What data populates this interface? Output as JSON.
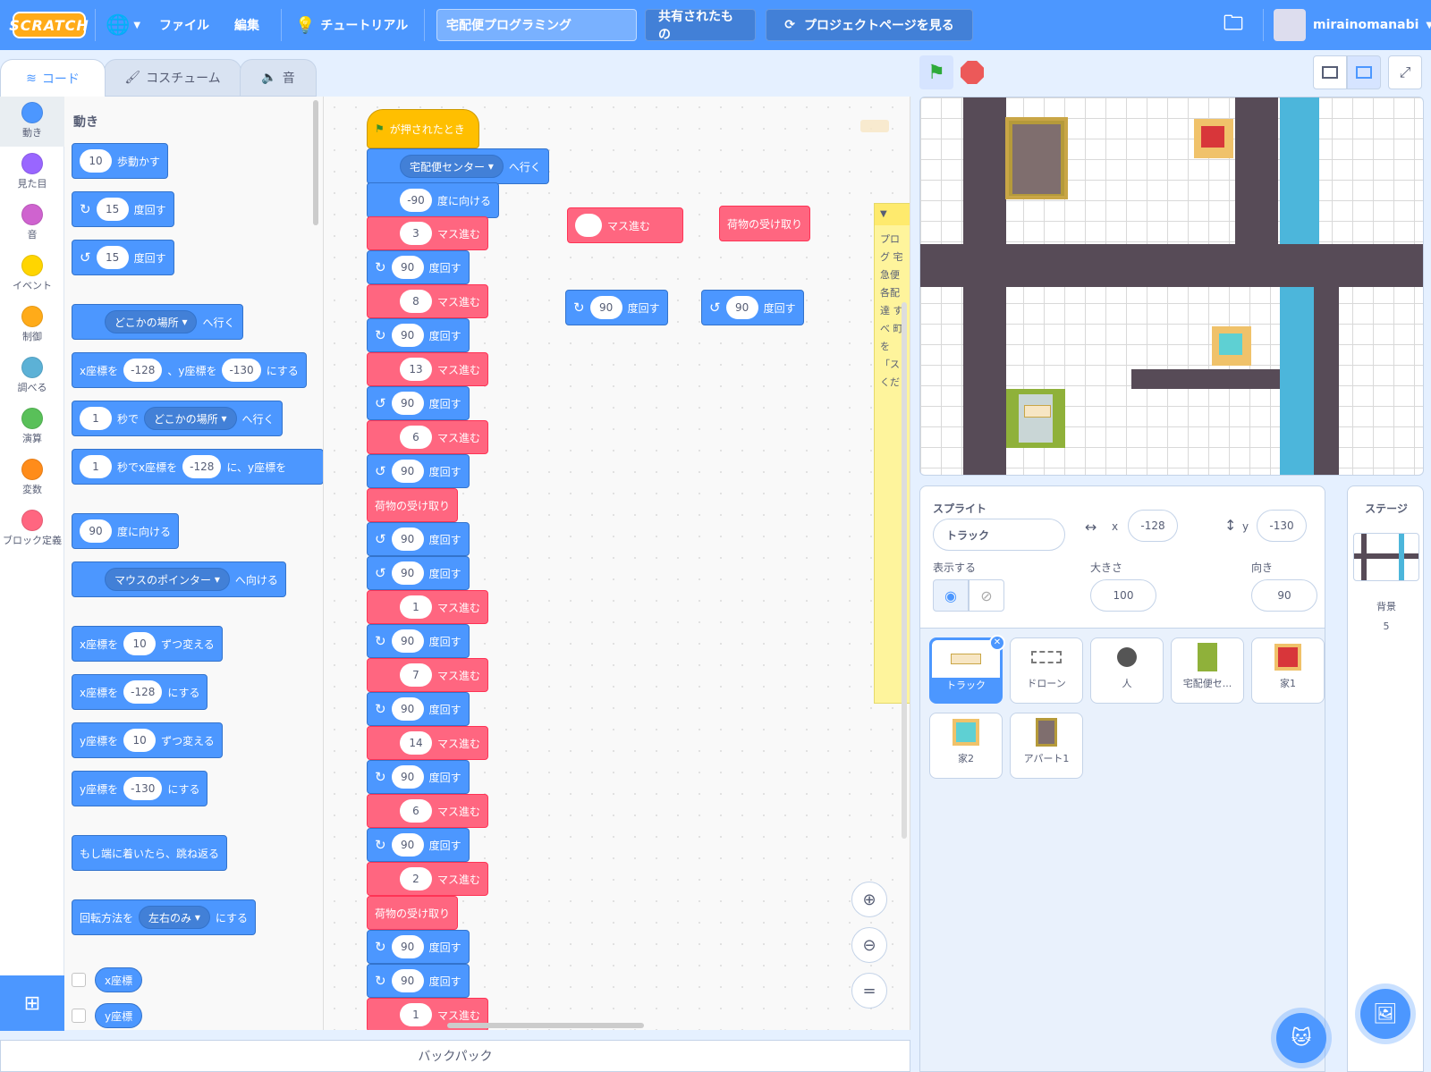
{
  "menubar": {
    "logo": "SCRATCH",
    "language_icon": "globe-icon",
    "file": "ファイル",
    "edit": "編集",
    "tutorials": "チュートリアル",
    "project_title": "宅配便プログラミング",
    "shared": "共有されたもの",
    "see_project_page": "プロジェクトページを見る",
    "username": "mirainomanabi"
  },
  "tabs": {
    "code": "コード",
    "costumes": "コスチューム",
    "sounds": "音"
  },
  "categories": [
    {
      "label": "動き",
      "color": "#4c97ff"
    },
    {
      "label": "見た目",
      "color": "#9966ff"
    },
    {
      "label": "音",
      "color": "#cf63cf"
    },
    {
      "label": "イベント",
      "color": "#ffd500"
    },
    {
      "label": "制御",
      "color": "#ffab19"
    },
    {
      "label": "調べる",
      "color": "#5cb1d6"
    },
    {
      "label": "演算",
      "color": "#59c059"
    },
    {
      "label": "変数",
      "color": "#ff8c1a"
    },
    {
      "label": "ブロック定義",
      "color": "#ff6680"
    }
  ],
  "flyout": {
    "heading": "動き",
    "move": {
      "value": "10",
      "text": "歩動かす"
    },
    "turn_right": {
      "value": "15",
      "text": "度回す"
    },
    "turn_left": {
      "value": "15",
      "text": "度回す"
    },
    "goto": {
      "dropdown": "どこかの場所",
      "text": "へ行く"
    },
    "gotoxy": {
      "x_label": "x座標を",
      "x": "-128",
      "y_label": "、y座標を",
      "y": "-130",
      "end": "にする"
    },
    "glide": {
      "secs": "1",
      "mid": "秒で",
      "dropdown": "どこかの場所",
      "end": "へ行く"
    },
    "glidexy": {
      "secs": "1",
      "mid": "秒でx座標を",
      "x": "-128",
      "end": "に、y座標を"
    },
    "point_dir": {
      "value": "90",
      "text": "度に向ける"
    },
    "point_towards": {
      "dropdown": "マウスのポインター",
      "text": "へ向ける"
    },
    "change_x": {
      "label": "x座標を",
      "value": "10",
      "text": "ずつ変える"
    },
    "set_x": {
      "label": "x座標を",
      "value": "-128",
      "text": "にする"
    },
    "change_y": {
      "label": "y座標を",
      "value": "10",
      "text": "ずつ変える"
    },
    "set_y": {
      "label": "y座標を",
      "value": "-130",
      "text": "にする"
    },
    "bounce": "もし端に着いたら、跳ね返る",
    "rotation": {
      "label": "回転方法を",
      "dropdown": "左右のみ",
      "end": "にする"
    },
    "xpos": "x座標",
    "ypos": "y座標"
  },
  "script": {
    "hat": "が押されたとき",
    "goto_dropdown": "宅配便センター",
    "goto_text": "へ行く",
    "point_value": "-90",
    "point_text": "度に向ける",
    "steps": [
      {
        "type": "move",
        "value": "3"
      },
      {
        "type": "right",
        "value": "90"
      },
      {
        "type": "move",
        "value": "8"
      },
      {
        "type": "right",
        "value": "90"
      },
      {
        "type": "move",
        "value": "13"
      },
      {
        "type": "left",
        "value": "90"
      },
      {
        "type": "move",
        "value": "6"
      },
      {
        "type": "left",
        "value": "90"
      },
      {
        "type": "pickup"
      },
      {
        "type": "left",
        "value": "90"
      },
      {
        "type": "left",
        "value": "90"
      },
      {
        "type": "move",
        "value": "1"
      },
      {
        "type": "right",
        "value": "90"
      },
      {
        "type": "move",
        "value": "7"
      },
      {
        "type": "right",
        "value": "90"
      },
      {
        "type": "move",
        "value": "14"
      },
      {
        "type": "right",
        "value": "90"
      },
      {
        "type": "move",
        "value": "6"
      },
      {
        "type": "right",
        "value": "90"
      },
      {
        "type": "move",
        "value": "2"
      },
      {
        "type": "pickup"
      },
      {
        "type": "right",
        "value": "90"
      },
      {
        "type": "right",
        "value": "90"
      },
      {
        "type": "move",
        "value": "1"
      }
    ],
    "move_text": "マス進む",
    "turn_text": "度回す",
    "pickup_text": "荷物の受け取り"
  },
  "loose": {
    "move_text": "マス進む",
    "pickup_text": "荷物の受け取り",
    "right_value": "90",
    "left_value": "90",
    "turn_text": "度回す"
  },
  "note_text": "プログ 宅急便 各配達 すべ 町を 「ス くだ",
  "sprite_info": {
    "sprite_label": "スプライト",
    "name": "トラック",
    "x_label": "x",
    "x": "-128",
    "y_label": "y",
    "y": "-130",
    "show_label": "表示する",
    "size_label": "大きさ",
    "size": "100",
    "direction_label": "向き",
    "direction": "90"
  },
  "sprites": [
    "トラック",
    "ドローン",
    "人",
    "宅配便セ...",
    "家1",
    "家2",
    "アパート1"
  ],
  "stage_panel": {
    "title": "ステージ",
    "backdrop_label": "背景",
    "backdrop_count": "5"
  },
  "backpack": "バックパック"
}
